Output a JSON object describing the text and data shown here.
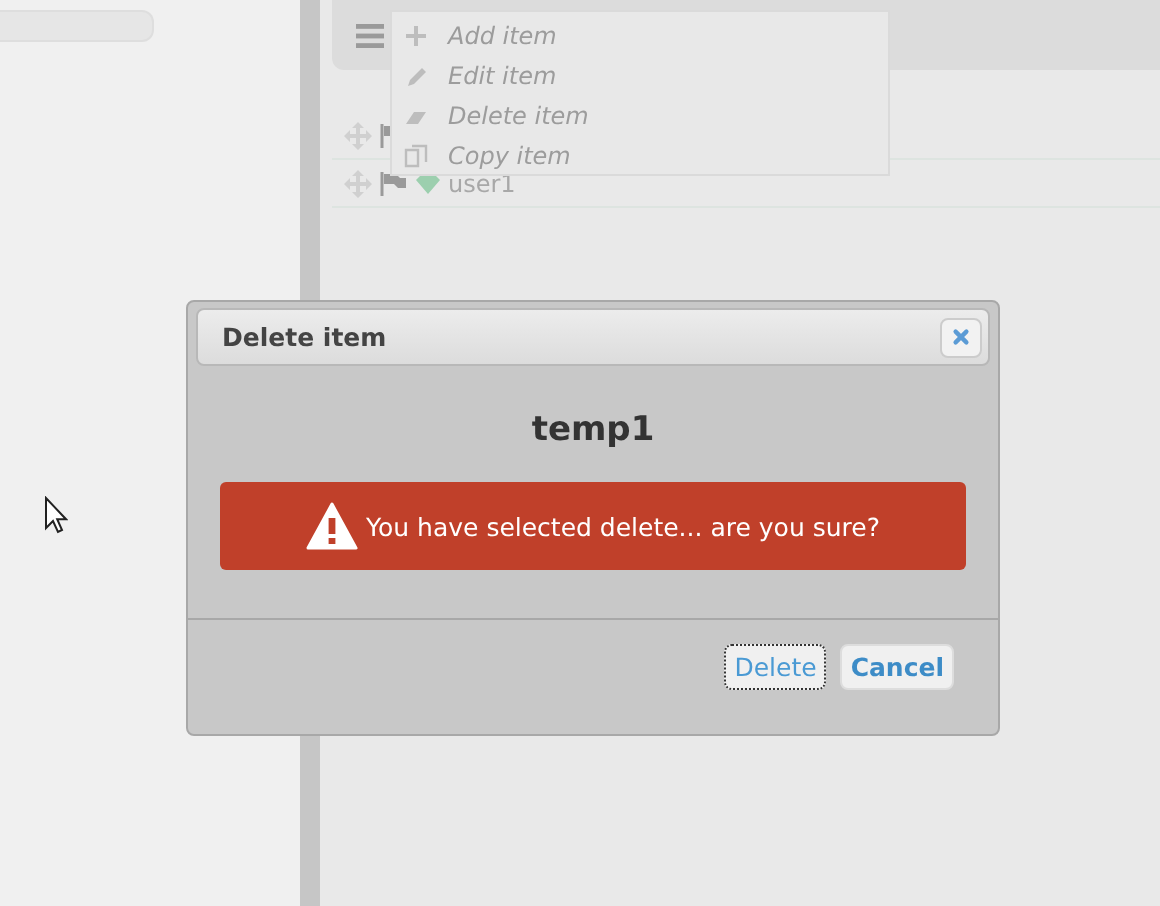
{
  "menu": {
    "items": [
      {
        "label": "Add item",
        "kind": "add"
      },
      {
        "label": "Edit item",
        "kind": "edit"
      },
      {
        "label": "Delete item",
        "kind": "delete"
      },
      {
        "label": "Copy item",
        "kind": "copy"
      }
    ]
  },
  "rows": [
    {},
    {
      "label": "user1"
    }
  ],
  "dialog": {
    "title": "Delete item",
    "heading": "temp1",
    "alert": "You have selected delete... are you sure?",
    "buttons": [
      {
        "label": "Delete",
        "focused": true
      },
      {
        "label": "Cancel",
        "focused": false
      }
    ]
  }
}
